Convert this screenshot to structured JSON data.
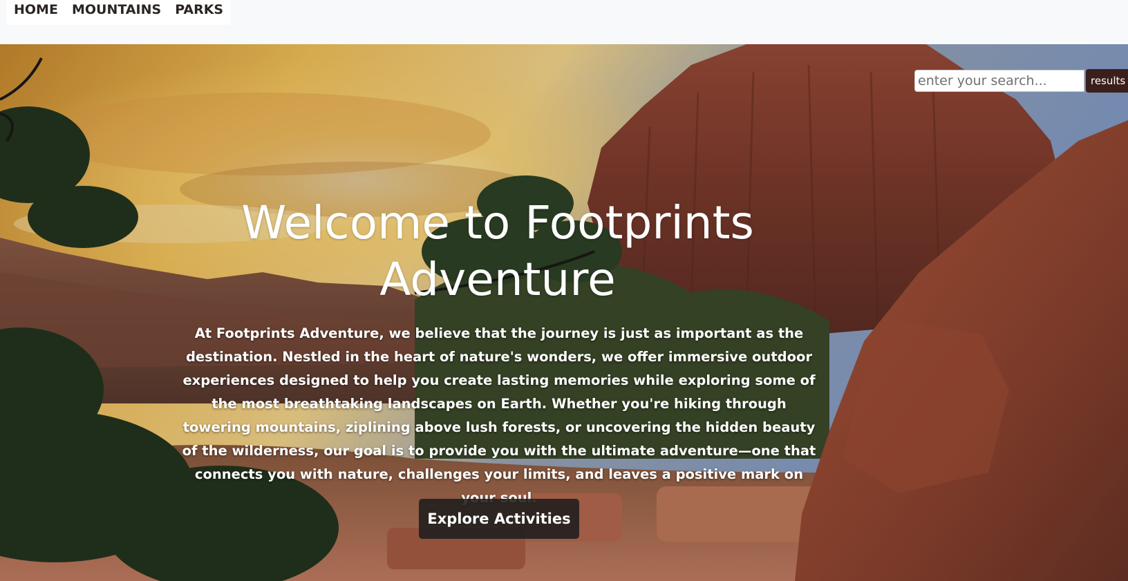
{
  "nav": {
    "items": [
      {
        "label": "HOME"
      },
      {
        "label": "MOUNTAINS"
      },
      {
        "label": "PARKS"
      }
    ]
  },
  "search": {
    "placeholder": "enter your search...",
    "button_label": "results"
  },
  "hero": {
    "title": "Welcome to Footprints Adventure",
    "intro": "At Footprints Adventure, we believe that the journey is just as important as the destination. Nestled in the heart of nature's wonders, we offer immersive outdoor experiences designed to help you create lasting memories while exploring some of the most breathtaking landscapes on Earth. Whether you're hiking through towering mountains, ziplining above lush forests, or uncovering the hidden beauty of the wilderness, our goal is to provide you with the ultimate adventure—one that connects you with nature, challenges your limits, and leaves a positive mark on your soul.",
    "cta_label": "Explore Activities"
  },
  "colors": {
    "topbar": "#f8f9fa",
    "nav_text": "#2b2522",
    "search_button": "#3a1f1c",
    "cta_background": "#1e1e1e",
    "sky_glow": "#ffd27a",
    "rock": "#a4503a"
  }
}
